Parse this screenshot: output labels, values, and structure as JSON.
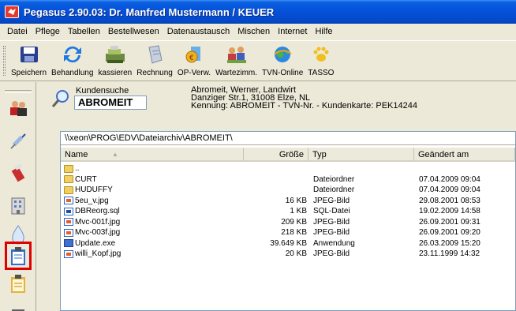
{
  "window": {
    "title": "Pegasus  2.90.03: Dr. Manfred Mustermann / KEUER"
  },
  "menu": [
    {
      "label": "Datei"
    },
    {
      "label": "Pflege"
    },
    {
      "label": "Tabellen"
    },
    {
      "label": "Bestellwesen"
    },
    {
      "label": "Datenaustausch"
    },
    {
      "label": "Mischen"
    },
    {
      "label": "Internet"
    },
    {
      "label": "Hilfe"
    }
  ],
  "toolbar": {
    "speichern": "Speichern",
    "behandlung": "Behandlung",
    "kassieren": "kassieren",
    "rechnung": "Rechnung",
    "opverw": "OP-Verw.",
    "wartezimm": "Wartezimm.",
    "tvnonline": "TVN-Online",
    "tasso": "TASSO"
  },
  "customer": {
    "search_label": "Kundensuche",
    "search_value": "ABROMEIT",
    "info_line1": "Abromeit, Werner, Landwirt",
    "info_line2": "Danziger Str.1, 31008 Elze, NL",
    "info_line3": "Kennung: ABROMEIT   - TVN-Nr. - Kundenkarte: PEK14244"
  },
  "browser": {
    "path": "\\\\xeon\\PROG\\EDV\\Dateiarchiv\\ABROMEIT\\",
    "columns": {
      "name": "Name",
      "size": "Größe",
      "type": "Typ",
      "date": "Geändert am"
    },
    "files": [
      {
        "icon": "folder",
        "name": "..",
        "size": "",
        "type": "",
        "date": ""
      },
      {
        "icon": "folder",
        "name": "CURT",
        "size": "",
        "type": "Dateiordner",
        "date": "07.04.2009 09:04"
      },
      {
        "icon": "folder",
        "name": "HUDUFFY",
        "size": "",
        "type": "Dateiordner",
        "date": "07.04.2009 09:04"
      },
      {
        "icon": "jpg",
        "name": "5eu_v.jpg",
        "size": "16 KB",
        "type": "JPEG-Bild",
        "date": "29.08.2001 08:53"
      },
      {
        "icon": "sql",
        "name": "DBReorg.sql",
        "size": "1 KB",
        "type": "SQL-Datei",
        "date": "19.02.2009 14:58"
      },
      {
        "icon": "jpg",
        "name": "Mvc-001f.jpg",
        "size": "209 KB",
        "type": "JPEG-Bild",
        "date": "26.09.2001 09:31"
      },
      {
        "icon": "jpg",
        "name": "Mvc-003f.jpg",
        "size": "218 KB",
        "type": "JPEG-Bild",
        "date": "26.09.2001 09:20"
      },
      {
        "icon": "exe",
        "name": "Update.exe",
        "size": "39.649 KB",
        "type": "Anwendung",
        "date": "26.03.2009 15:20"
      },
      {
        "icon": "jpg",
        "name": "willi_Kopf.jpg",
        "size": "20 KB",
        "type": "JPEG-Bild",
        "date": "23.11.1999 14:32"
      }
    ]
  }
}
